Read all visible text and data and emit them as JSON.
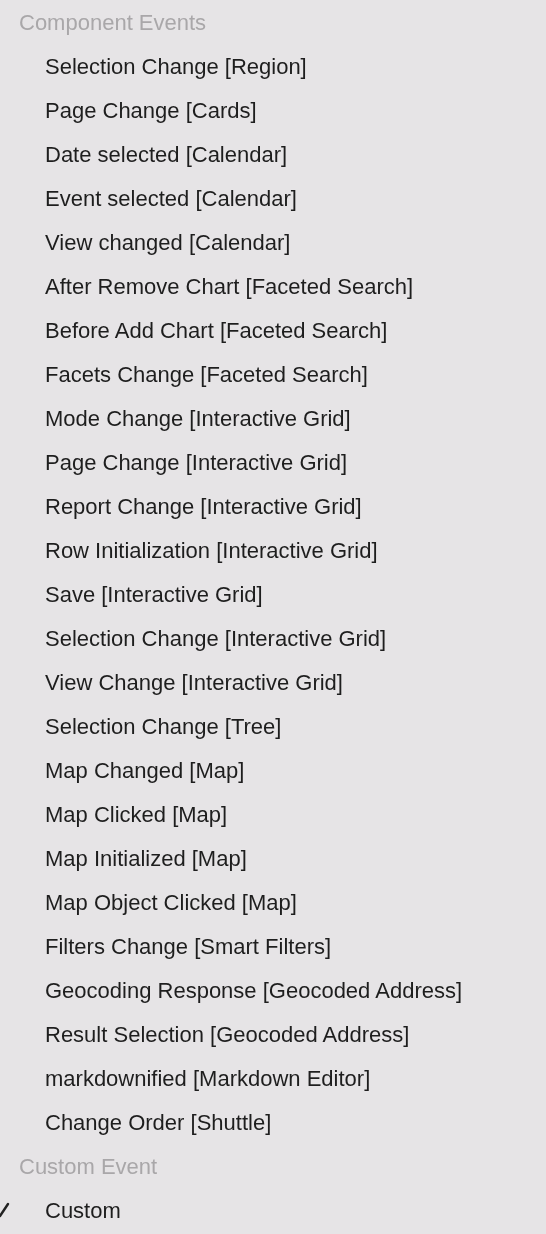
{
  "groups": [
    {
      "header": "Component Events",
      "items": [
        {
          "label": "Selection Change [Region]",
          "selected": false
        },
        {
          "label": "Page Change [Cards]",
          "selected": false
        },
        {
          "label": "Date selected [Calendar]",
          "selected": false
        },
        {
          "label": "Event selected [Calendar]",
          "selected": false
        },
        {
          "label": "View changed [Calendar]",
          "selected": false
        },
        {
          "label": "After Remove Chart [Faceted Search]",
          "selected": false
        },
        {
          "label": "Before Add Chart [Faceted Search]",
          "selected": false
        },
        {
          "label": "Facets Change [Faceted Search]",
          "selected": false
        },
        {
          "label": "Mode Change [Interactive Grid]",
          "selected": false
        },
        {
          "label": "Page Change [Interactive Grid]",
          "selected": false
        },
        {
          "label": "Report Change [Interactive Grid]",
          "selected": false
        },
        {
          "label": "Row Initialization [Interactive Grid]",
          "selected": false
        },
        {
          "label": "Save [Interactive Grid]",
          "selected": false
        },
        {
          "label": "Selection Change [Interactive Grid]",
          "selected": false
        },
        {
          "label": "View Change [Interactive Grid]",
          "selected": false
        },
        {
          "label": "Selection Change [Tree]",
          "selected": false
        },
        {
          "label": "Map Changed [Map]",
          "selected": false
        },
        {
          "label": "Map Clicked [Map]",
          "selected": false
        },
        {
          "label": "Map Initialized [Map]",
          "selected": false
        },
        {
          "label": "Map Object Clicked [Map]",
          "selected": false
        },
        {
          "label": "Filters Change [Smart Filters]",
          "selected": false
        },
        {
          "label": "Geocoding Response [Geocoded Address]",
          "selected": false
        },
        {
          "label": "Result Selection [Geocoded Address]",
          "selected": false
        },
        {
          "label": "markdownified [Markdown Editor]",
          "selected": false
        },
        {
          "label": "Change Order [Shuttle]",
          "selected": false
        }
      ]
    },
    {
      "header": "Custom Event",
      "items": [
        {
          "label": "Custom",
          "selected": true
        }
      ]
    }
  ]
}
